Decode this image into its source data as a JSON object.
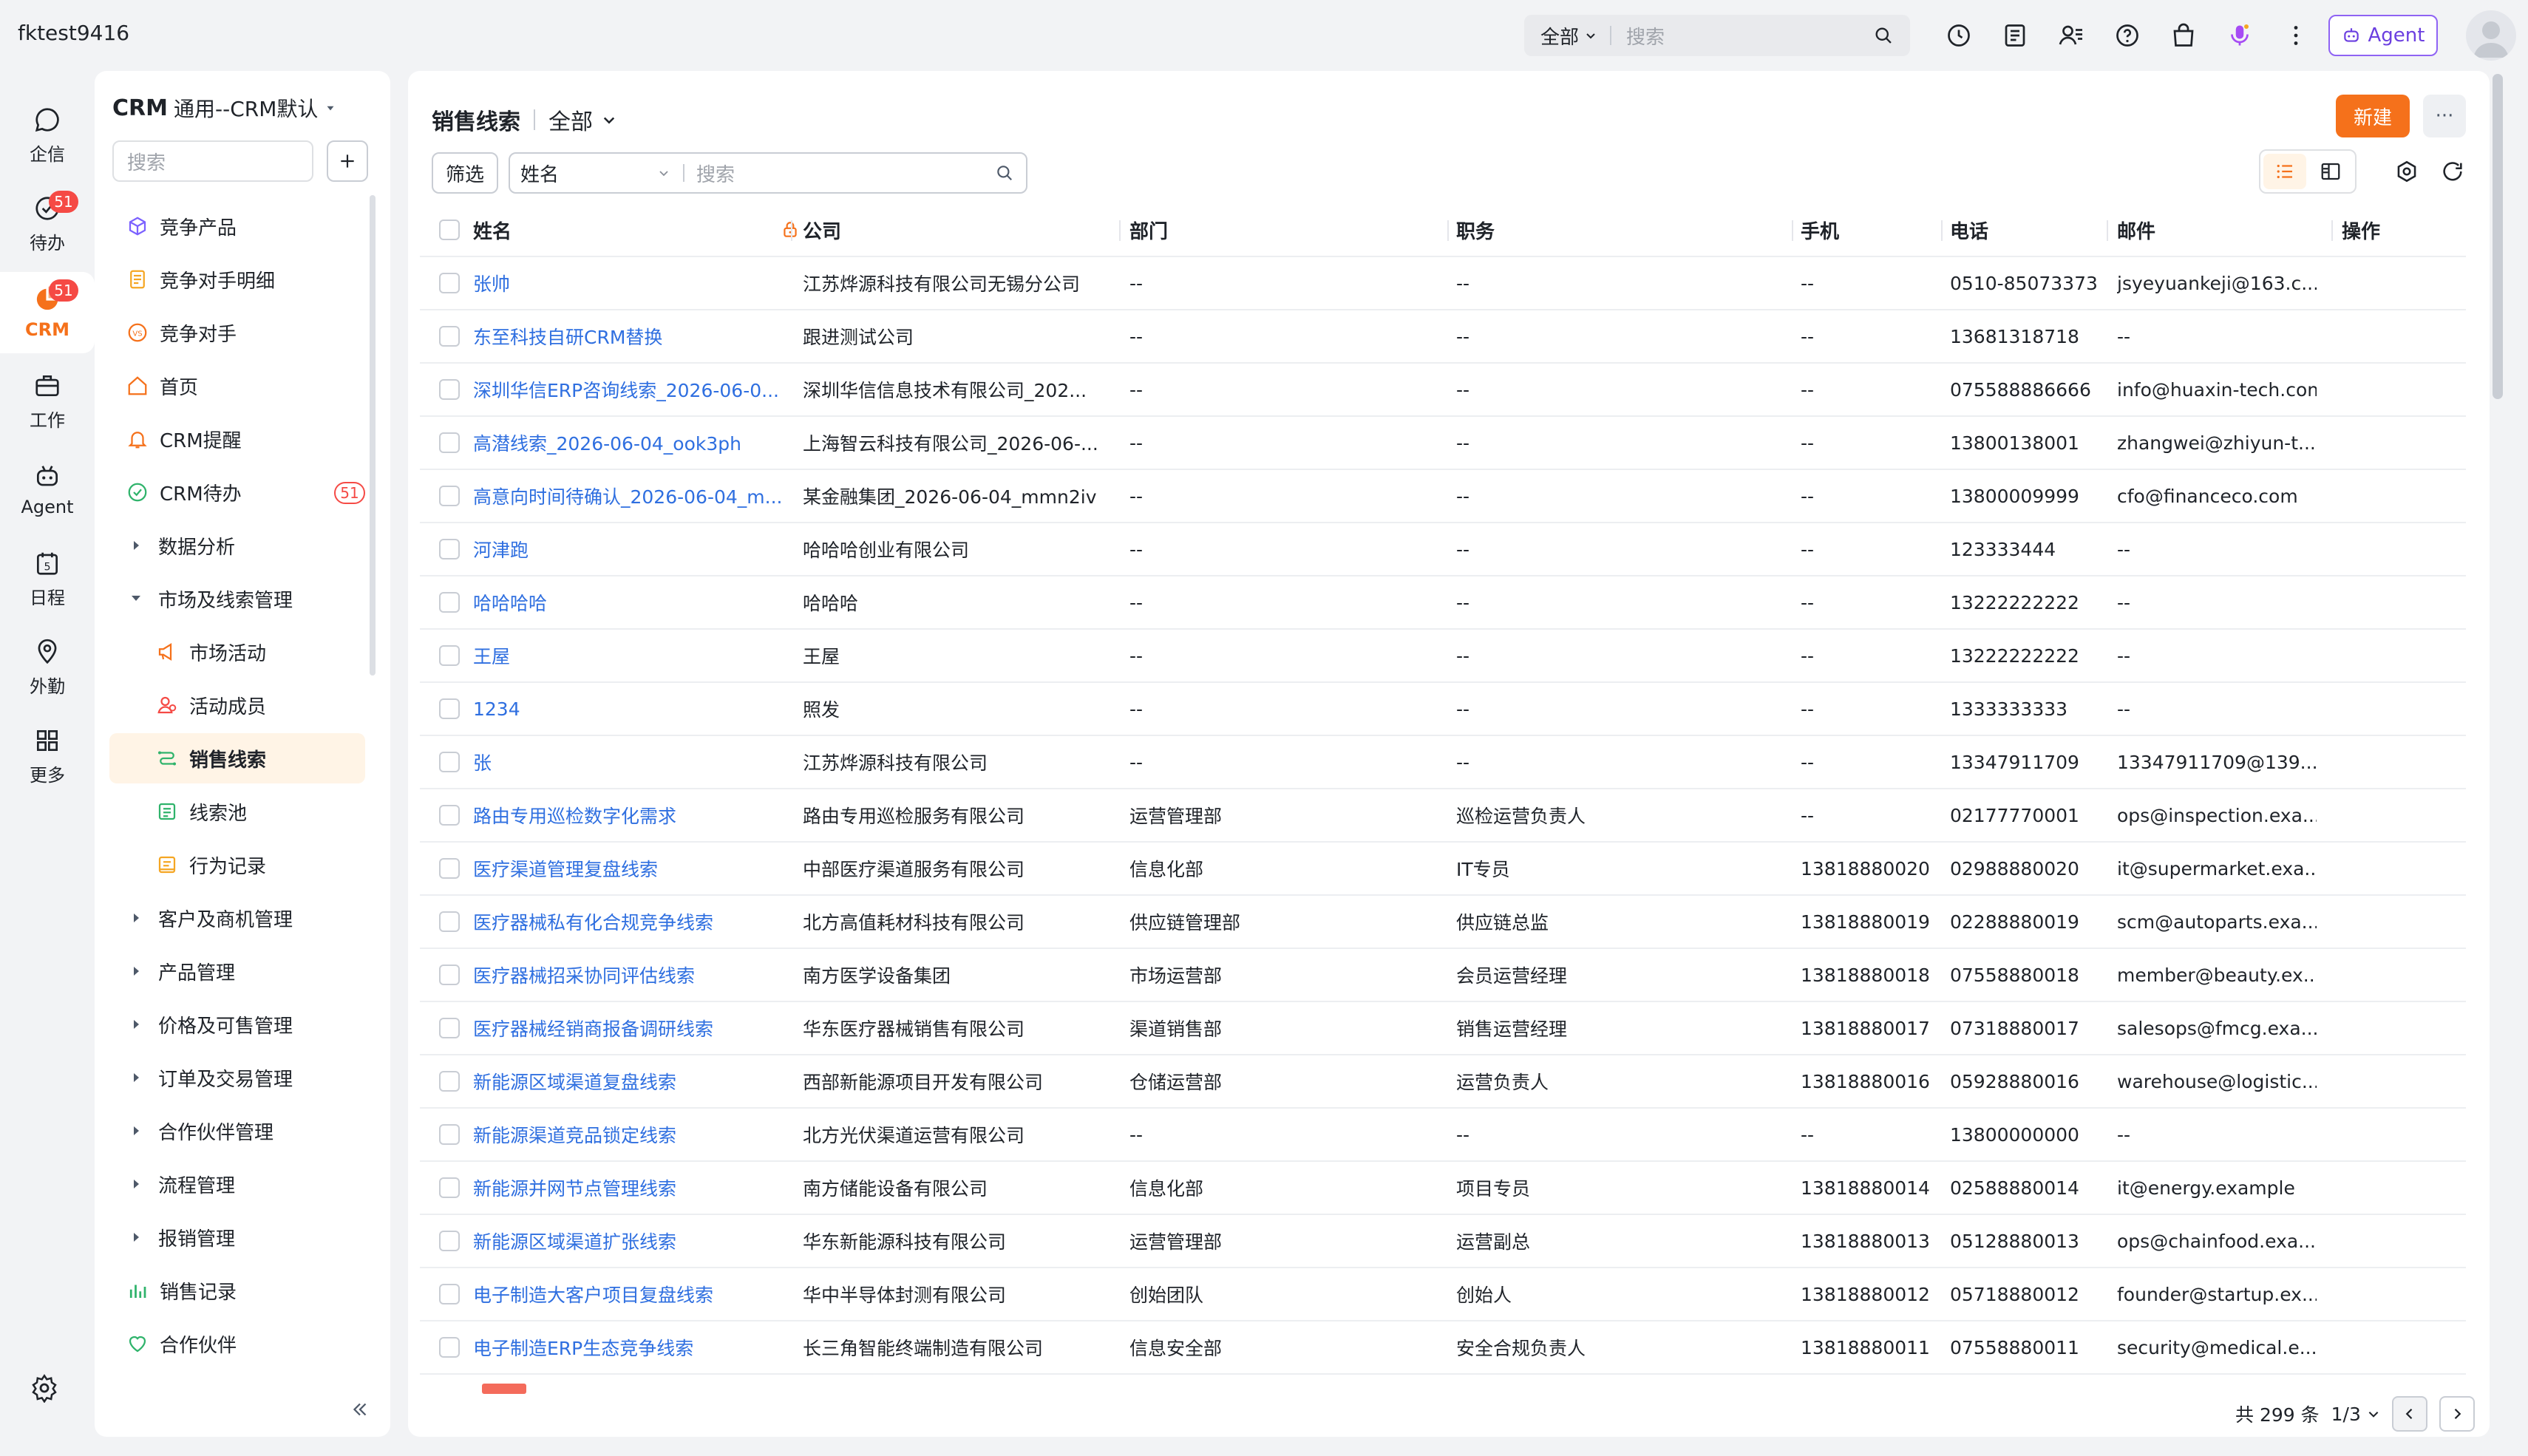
{
  "topbar": {
    "account": "fktest9416",
    "search_scope": "全部",
    "search_placeholder": "搜索",
    "agent_label": "Agent"
  },
  "rail": {
    "items": [
      {
        "label": "企信",
        "icon": "chat-icon"
      },
      {
        "label": "待办",
        "icon": "todo-check-icon",
        "badge": "51"
      },
      {
        "label": "CRM",
        "icon": "crm-pie-icon",
        "badge": "51",
        "active": true
      },
      {
        "label": "工作",
        "icon": "briefcase-icon"
      },
      {
        "label": "Agent",
        "icon": "robot-icon"
      },
      {
        "label": "日程",
        "icon": "calendar-icon"
      },
      {
        "label": "外勤",
        "icon": "location-pin-icon"
      },
      {
        "label": "更多",
        "icon": "grid-icon"
      }
    ]
  },
  "sidebar": {
    "title_bold": "CRM",
    "title_rest": "通用--CRM默认",
    "search_placeholder": "搜索",
    "items": [
      {
        "label": "竞争产品",
        "icon": "product-cube-icon",
        "color": "#7b61ff"
      },
      {
        "label": "竞争对手明细",
        "icon": "detail-doc-icon",
        "color": "#f5a623"
      },
      {
        "label": "竞争对手",
        "icon": "vs-icon",
        "color": "#f5711b"
      },
      {
        "label": "首页",
        "icon": "home-icon",
        "color": "#f5711b"
      },
      {
        "label": "CRM提醒",
        "icon": "bell-icon",
        "color": "#f5711b"
      },
      {
        "label": "CRM待办",
        "icon": "check-circle-icon",
        "color": "#2fb36b",
        "badge": "51"
      },
      {
        "label": "数据分析",
        "caret": "right"
      },
      {
        "label": "市场及线索管理",
        "caret": "down"
      },
      {
        "label": "市场活动",
        "icon": "megaphone-icon",
        "color": "#f5711b",
        "sub": true
      },
      {
        "label": "活动成员",
        "icon": "members-icon",
        "color": "#f54a45",
        "sub": true
      },
      {
        "label": "销售线索",
        "icon": "leads-flow-icon",
        "color": "#2fb36b",
        "sub": true,
        "active": true
      },
      {
        "label": "线索池",
        "icon": "pool-icon",
        "color": "#2fb36b",
        "sub": true
      },
      {
        "label": "行为记录",
        "icon": "record-icon",
        "color": "#f5a623",
        "sub": true
      },
      {
        "label": "客户及商机管理",
        "caret": "right"
      },
      {
        "label": "产品管理",
        "caret": "right"
      },
      {
        "label": "价格及可售管理",
        "caret": "right"
      },
      {
        "label": "订单及交易管理",
        "caret": "right"
      },
      {
        "label": "合作伙伴管理",
        "caret": "right"
      },
      {
        "label": "流程管理",
        "caret": "right"
      },
      {
        "label": "报销管理",
        "caret": "right"
      },
      {
        "label": "销售记录",
        "icon": "bar-chart-icon",
        "color": "#2fb36b"
      },
      {
        "label": "合作伙伴",
        "icon": "handshake-icon",
        "color": "#2fb36b"
      }
    ]
  },
  "main": {
    "title": "销售线索",
    "scope": "全部",
    "new_label": "新建",
    "more_label": "···",
    "filter_label": "筛选",
    "filter_field": "姓名",
    "filter_placeholder": "搜索",
    "columns": [
      "姓名",
      "公司",
      "部门",
      "职务",
      "手机",
      "电话",
      "邮件",
      "操作"
    ],
    "rows": [
      {
        "name": "张帅",
        "company": "江苏烨源科技有限公司无锡分公司",
        "dept": "--",
        "title": "--",
        "mobile": "--",
        "phone": "0510-85073373",
        "email": "jsyeyuankeji@163.c..."
      },
      {
        "name": "东至科技自研CRM替换",
        "company": "跟进测试公司",
        "dept": "--",
        "title": "--",
        "mobile": "--",
        "phone": "13681318718",
        "email": "--"
      },
      {
        "name": "深圳华信ERP咨询线索_2026-06-0...",
        "company": "深圳华信信息技术有限公司_202...",
        "dept": "--",
        "title": "--",
        "mobile": "--",
        "phone": "075588886666",
        "email": "info@huaxin-tech.com"
      },
      {
        "name": "高潜线索_2026-06-04_ook3ph",
        "company": "上海智云科技有限公司_2026-06-...",
        "dept": "--",
        "title": "--",
        "mobile": "--",
        "phone": "13800138001",
        "email": "zhangwei@zhiyun-t..."
      },
      {
        "name": "高意向时间待确认_2026-06-04_m...",
        "company": "某金融集团_2026-06-04_mmn2iv",
        "dept": "--",
        "title": "--",
        "mobile": "--",
        "phone": "13800009999",
        "email": "cfo@financeco.com"
      },
      {
        "name": "河津跑",
        "company": "哈哈哈创业有限公司",
        "dept": "--",
        "title": "--",
        "mobile": "--",
        "phone": "123333444",
        "email": "--"
      },
      {
        "name": "哈哈哈哈",
        "company": "哈哈哈",
        "dept": "--",
        "title": "--",
        "mobile": "--",
        "phone": "13222222222",
        "email": "--"
      },
      {
        "name": "王屋",
        "company": "王屋",
        "dept": "--",
        "title": "--",
        "mobile": "--",
        "phone": "13222222222",
        "email": "--"
      },
      {
        "name": "1234",
        "company": "照发",
        "dept": "--",
        "title": "--",
        "mobile": "--",
        "phone": "1333333333",
        "email": "--"
      },
      {
        "name": "张",
        "company": "江苏烨源科技有限公司",
        "dept": "--",
        "title": "--",
        "mobile": "--",
        "phone": "13347911709",
        "email": "13347911709@139...."
      },
      {
        "name": "路由专用巡检数字化需求",
        "company": "路由专用巡检服务有限公司",
        "dept": "运营管理部",
        "title": "巡检运营负责人",
        "mobile": "--",
        "phone": "02177770001",
        "email": "ops@inspection.exa..."
      },
      {
        "name": "医疗渠道管理复盘线索",
        "company": "中部医疗渠道服务有限公司",
        "dept": "信息化部",
        "title": "IT专员",
        "mobile": "13818880020",
        "phone": "02988880020",
        "email": "it@supermarket.exa..."
      },
      {
        "name": "医疗器械私有化合规竞争线索",
        "company": "北方高值耗材科技有限公司",
        "dept": "供应链管理部",
        "title": "供应链总监",
        "mobile": "13818880019",
        "phone": "02288880019",
        "email": "scm@autoparts.exa..."
      },
      {
        "name": "医疗器械招采协同评估线索",
        "company": "南方医学设备集团",
        "dept": "市场运营部",
        "title": "会员运营经理",
        "mobile": "13818880018",
        "phone": "07558880018",
        "email": "member@beauty.ex..."
      },
      {
        "name": "医疗器械经销商报备调研线索",
        "company": "华东医疗器械销售有限公司",
        "dept": "渠道销售部",
        "title": "销售运营经理",
        "mobile": "13818880017",
        "phone": "07318880017",
        "email": "salesops@fmcg.exa..."
      },
      {
        "name": "新能源区域渠道复盘线索",
        "company": "西部新能源项目开发有限公司",
        "dept": "仓储运营部",
        "title": "运营负责人",
        "mobile": "13818880016",
        "phone": "05928880016",
        "email": "warehouse@logistic..."
      },
      {
        "name": "新能源渠道竞品锁定线索",
        "company": "北方光伏渠道运营有限公司",
        "dept": "--",
        "title": "--",
        "mobile": "--",
        "phone": "13800000000",
        "email": "--"
      },
      {
        "name": "新能源并网节点管理线索",
        "company": "南方储能设备有限公司",
        "dept": "信息化部",
        "title": "项目专员",
        "mobile": "13818880014",
        "phone": "02588880014",
        "email": "it@energy.example"
      },
      {
        "name": "新能源区域渠道扩张线索",
        "company": "华东新能源科技有限公司",
        "dept": "运营管理部",
        "title": "运营副总",
        "mobile": "13818880013",
        "phone": "05128880013",
        "email": "ops@chainfood.exa..."
      },
      {
        "name": "电子制造大客户项目复盘线索",
        "company": "华中半导体封测有限公司",
        "dept": "创始团队",
        "title": "创始人",
        "mobile": "13818880012",
        "phone": "05718880012",
        "email": "founder@startup.ex..."
      },
      {
        "name": "电子制造ERP生态竞争线索",
        "company": "长三角智能终端制造有限公司",
        "dept": "信息安全部",
        "title": "安全合规负责人",
        "mobile": "13818880011",
        "phone": "07558880011",
        "email": "security@medical.e..."
      }
    ],
    "pager": {
      "total": "共 299 条",
      "page": "1/3"
    }
  },
  "colors": {
    "accent": "#f5711b",
    "link": "#2f6fe0",
    "badge": "#f54a45",
    "agent": "#8f63f4"
  }
}
